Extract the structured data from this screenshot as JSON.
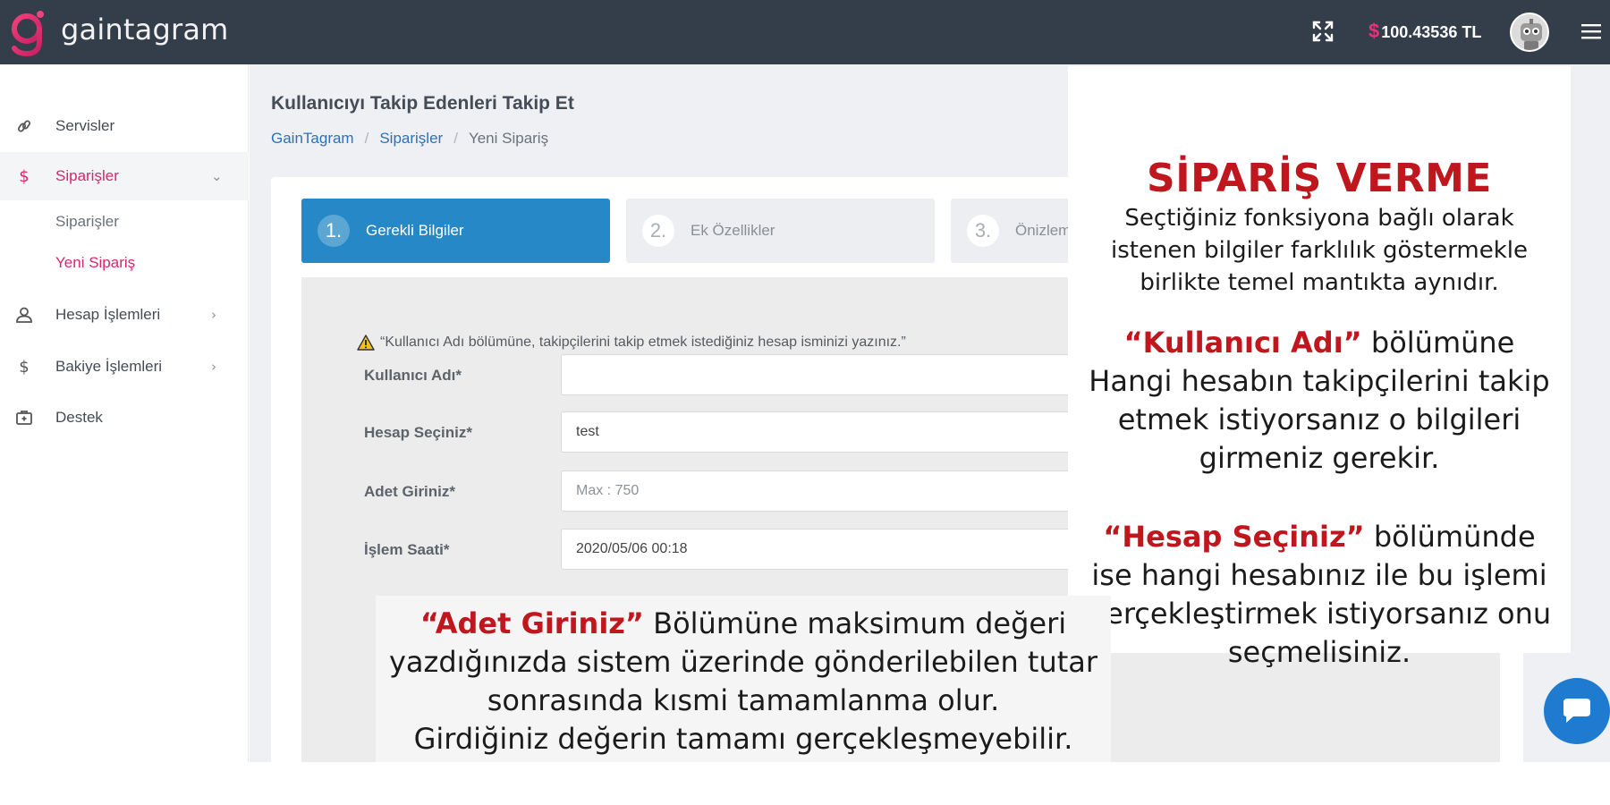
{
  "app": {
    "brand": "gaintagram",
    "balance": "100.43536 TL",
    "balance_symbol": "$",
    "accent_color": "#d6266e",
    "primary_color": "#2688c6"
  },
  "sidebar": {
    "items": [
      {
        "label": "Servisler",
        "icon": "link-icon"
      },
      {
        "label": "Siparişler",
        "icon": "dollar-icon",
        "active": true,
        "chevron": "⌄"
      },
      {
        "label": "Hesap İşlemleri",
        "icon": "user-icon",
        "chevron": "›"
      },
      {
        "label": "Bakiye İşlemleri",
        "icon": "dollar-icon",
        "chevron": "›"
      },
      {
        "label": "Destek",
        "icon": "medkit-icon"
      }
    ],
    "sub_items": [
      {
        "label": "Siparişler"
      },
      {
        "label": "Yeni Sipariş",
        "active": true
      }
    ]
  },
  "main": {
    "page_title": "Kullanıcıyı Takip Edenleri Takip Et",
    "breadcrumb": [
      "GainTagram",
      "Siparişler",
      "Yeni Sipariş"
    ],
    "steps": [
      {
        "num": "1.",
        "label": "Gerekli Bilgiler",
        "active": true
      },
      {
        "num": "2.",
        "label": "Ek Özellikler"
      },
      {
        "num": "3.",
        "label": "Önizlem"
      }
    ],
    "warning": "“Kullanıcı Adı bölümüne, takipçilerini takip etmek istediğiniz hesap isminizi yazınız.”",
    "fields": [
      {
        "label": "Kullanıcı Adı*",
        "value": ""
      },
      {
        "label": "Hesap Seçiniz*",
        "value": "test"
      },
      {
        "label": "Adet Giriniz*",
        "placeholder": "Max : 750"
      },
      {
        "label": "İşlem Saati*",
        "value": "2020/05/06 00:18"
      }
    ]
  },
  "annotation_right": {
    "title": "SİPARİŞ VERME",
    "intro": [
      "Seçtiğiniz fonksiyona bağlı olarak",
      "istenen bilgiler farklılık göstermekle",
      "birlikte temel mantıkta aynıdır."
    ],
    "p2_highlight": "“Kullanıcı Adı”",
    "p2_rest_first": " bölümüne",
    "p2_lines": [
      "Hangi hesabın takipçilerini takip",
      "etmek istiyorsanız o bilgileri",
      "girmeniz gerekir."
    ],
    "p3_highlight": "“Hesap Seçiniz”",
    "p3_rest_first": " bölümünde",
    "p3_lines": [
      "ise hangi hesabınız ile bu işlemi",
      "gerçekleştirmek istiyorsanız onu",
      "seçmelisiniz."
    ]
  },
  "annotation_bottom": {
    "highlight": "“Adet Giriniz”",
    "rest_first": " Bölümüne maksimum değeri",
    "lines": [
      "yazdığınızda sistem üzerinde gönderilebilen tutar",
      "sonrasında kısmi tamamlanma olur.",
      "Girdiğiniz değerin tamamı gerçekleşmeyebilir."
    ]
  }
}
